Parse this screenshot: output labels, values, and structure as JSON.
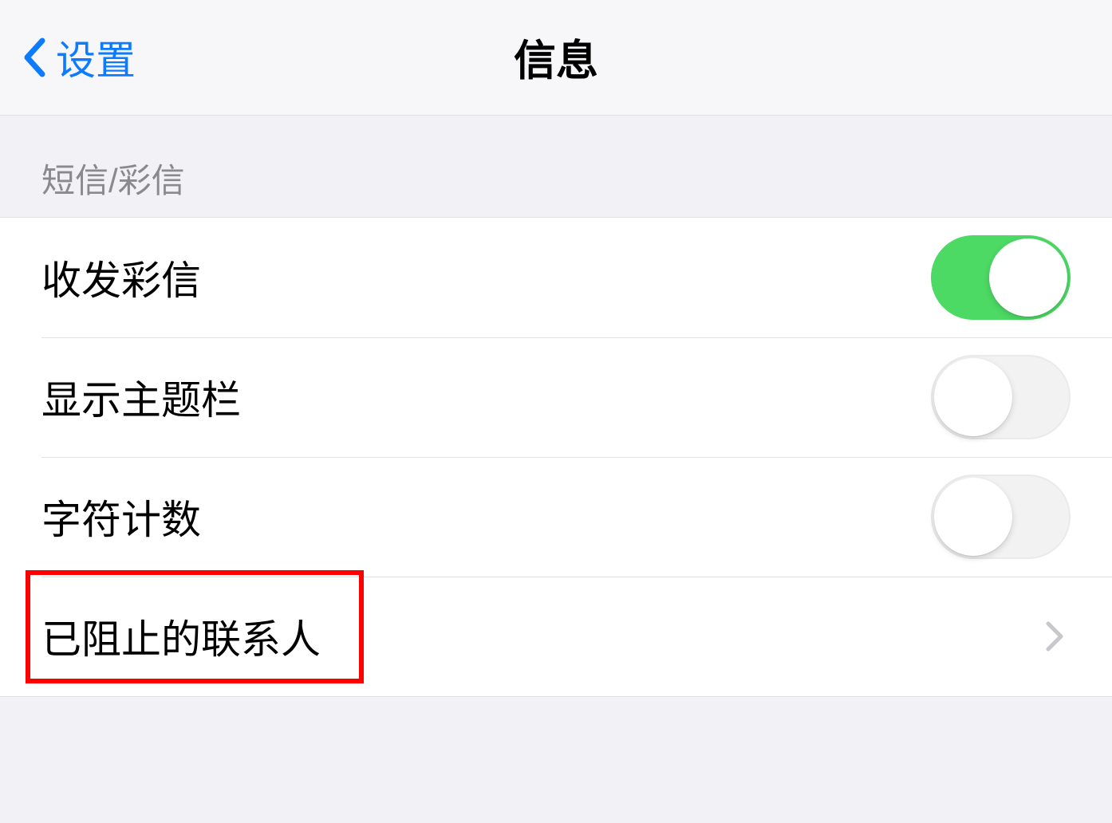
{
  "navbar": {
    "back_label": "设置",
    "title": "信息"
  },
  "section": {
    "header": "短信/彩信"
  },
  "rows": {
    "mms": {
      "label": "收发彩信",
      "toggle": true
    },
    "subject": {
      "label": "显示主题栏",
      "toggle": false
    },
    "char_count": {
      "label": "字符计数",
      "toggle": false
    },
    "blocked": {
      "label": "已阻止的联系人"
    }
  },
  "colors": {
    "accent": "#0c7bff",
    "toggle_on": "#4cd964",
    "highlight": "#ff0000"
  }
}
